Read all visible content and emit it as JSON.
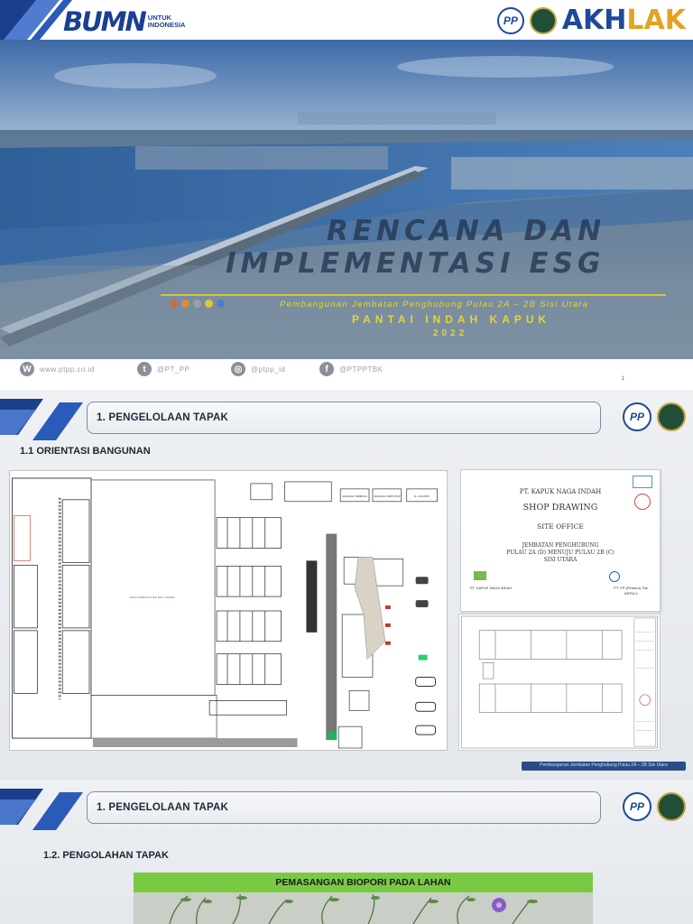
{
  "slide1": {
    "bumn_word": "BUMN",
    "bumn_tagline_1": "UNTUK",
    "bumn_tagline_2": "INDONESIA",
    "pp_logo": "PP",
    "akhlak_word_1": "AKH",
    "akhlak_word_2": "LAK",
    "title_line_1": "RENCANA DAN",
    "title_line_2": "IMPLEMENTASI ESG",
    "subtitle": "Pembangunan Jembatan Penghubung Pulau 2A – 2B Sisi Utara",
    "place": "PANTAI INDAH KAPUK",
    "year": "2022",
    "social": [
      {
        "icon": "W",
        "name": "website-icon",
        "text": "www.ptpp.co.id"
      },
      {
        "icon": "t",
        "name": "twitter-icon",
        "text": "@PT_PP"
      },
      {
        "icon": "◎",
        "name": "instagram-icon",
        "text": "@ptpp_id"
      },
      {
        "icon": "f",
        "name": "facebook-icon",
        "text": "@PTPPTBK"
      }
    ],
    "page_number": "1",
    "dot_colors": [
      "#c96b4a",
      "#e08a3a",
      "#9aa0a8",
      "#e7c23a",
      "#4a7fc6"
    ]
  },
  "slide2": {
    "section_title": "1.   PENGELOLAAN TAPAK",
    "sub_heading": "1.1 ORIENTASI BANGUNAN",
    "pp_logo": "PP",
    "doc_company": "PT. KAPUK NAGA INDAH",
    "doc_type": "SHOP DRAWING",
    "doc_object": "SITE OFFICE",
    "doc_project_1": "JEMBATAN PENGHUBUNG",
    "doc_project_2": "PULAU 2A (D) MENUJU PULAU 2B (C)",
    "doc_project_3": "SISI UTARA",
    "doc_left_label": "PT. KAPUK NAGA INDAH",
    "doc_right_label": "PT. PP (Persero) Tbk.",
    "doc_right_label_2": "INFRA 1",
    "plan_labels": {
      "area_left": "AREA FABRIKASI SISI BOX GIRDER",
      "gudang_terbuka": "GUDANG TERBUKA",
      "gudang_tertutup": "GUDANG TERTUTUP",
      "logistik": "R. LOGISTIK"
    },
    "footer": "Pembangunan Jembatan Penghubung Pulau 2A – 2B Sisi Utara"
  },
  "slide3": {
    "section_title": "1.   PENGELOLAAN TAPAK",
    "sub_heading": "1.2. PENGOLAHAN TAPAK",
    "pp_logo": "PP",
    "banner": "PEMASANGAN BIOPORI PADA LAHAN"
  }
}
